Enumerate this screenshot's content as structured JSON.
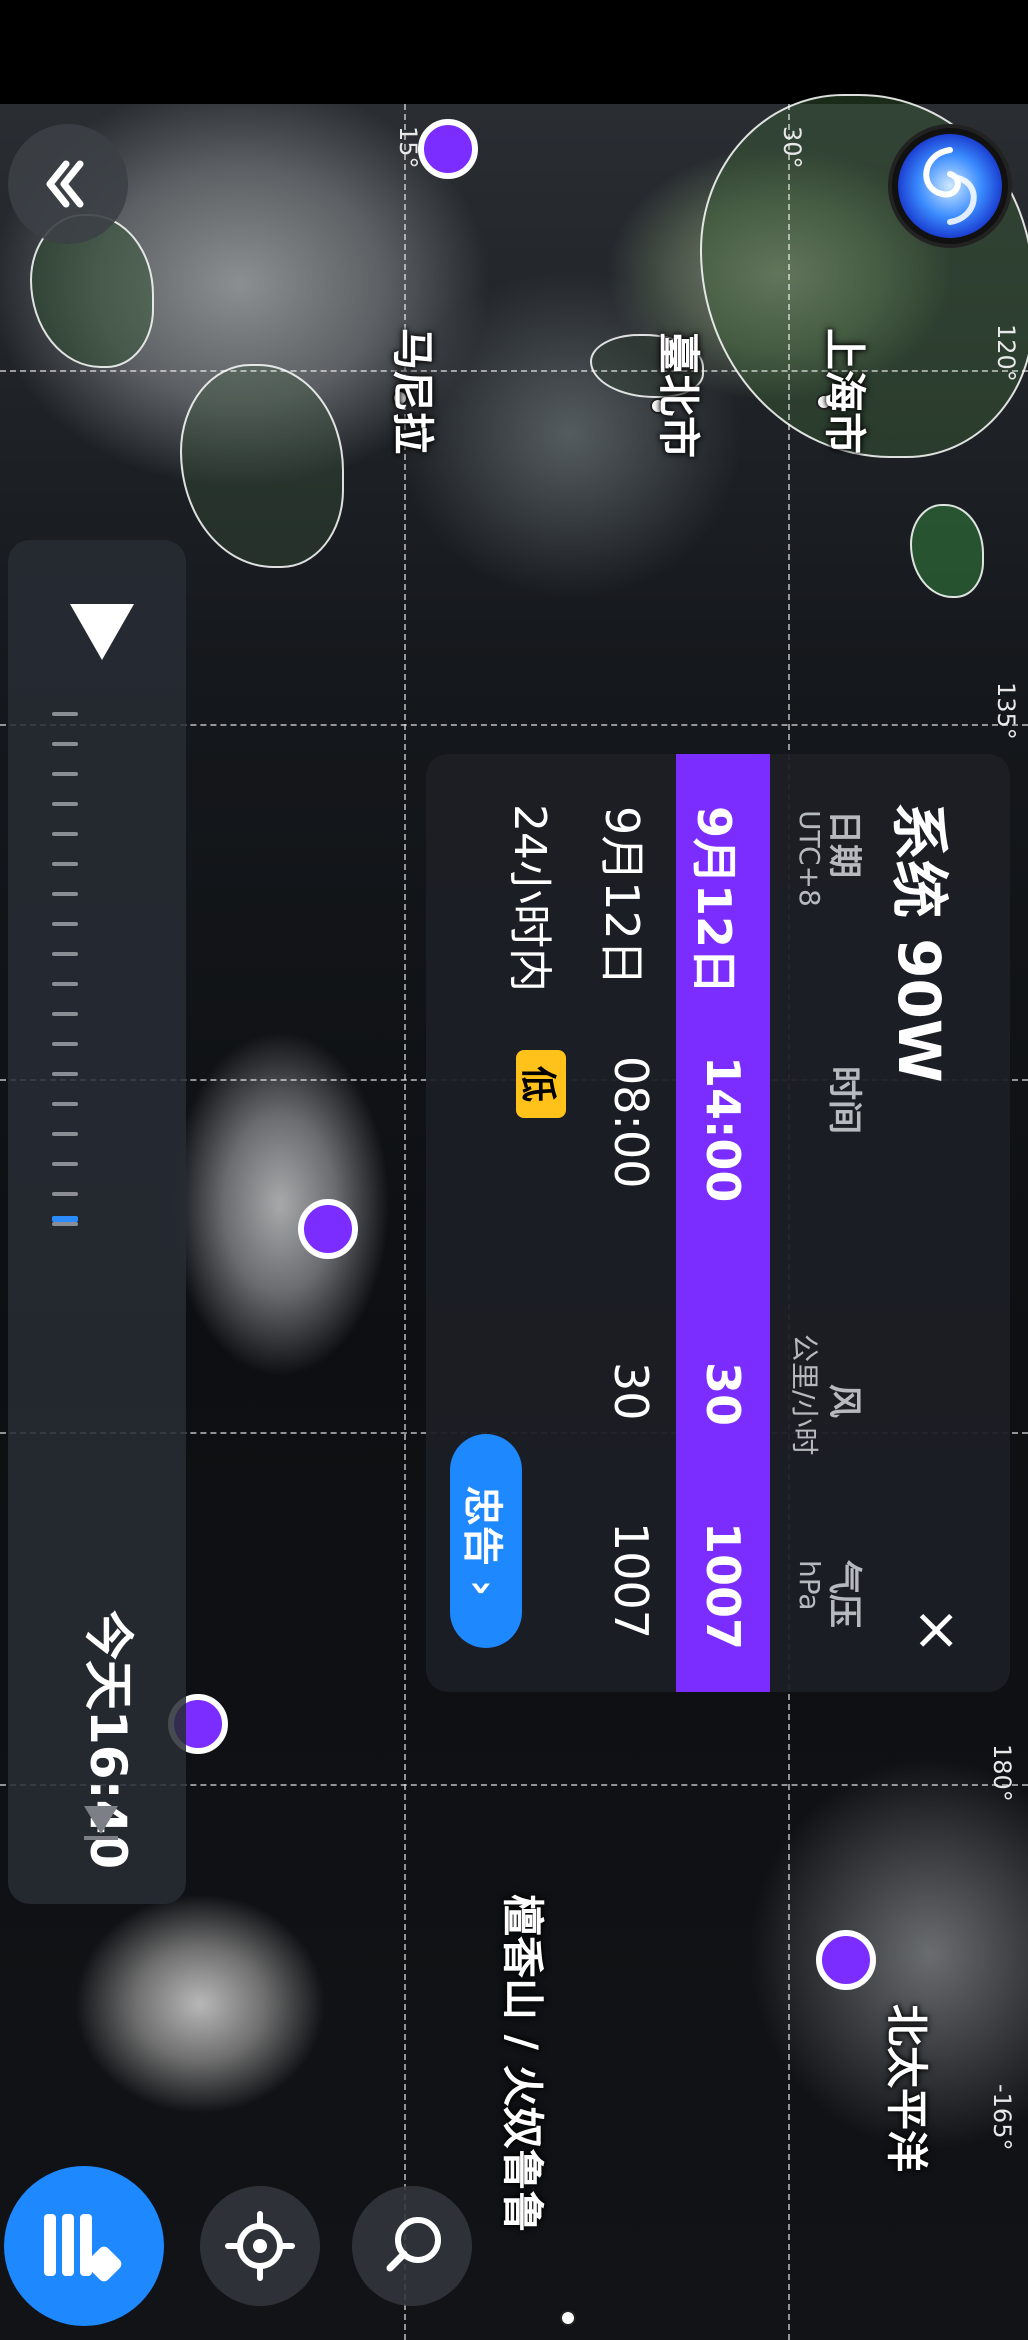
{
  "map": {
    "grid_labels": {
      "lat_15": "15°",
      "lat_30": "30°",
      "lon_120": "120°",
      "lon_135": "135°",
      "lon_180": "180°",
      "lon_neg165": "-165°"
    },
    "places": {
      "shanghai": "上海市",
      "taipei": "臺北市",
      "manila": "马尼拉",
      "north_pacific": "北太平洋",
      "honolulu": "檀香山 / 火奴鲁鲁"
    }
  },
  "timeline": {
    "current_label": "今天16:40"
  },
  "storm_card": {
    "title": "系统 90W",
    "close_label": "×",
    "header": {
      "date": "日期",
      "timezone": "UTC+8",
      "time": "时间",
      "wind": "风",
      "wind_unit": "公里/小时",
      "pressure": "气压",
      "pressure_unit": "hPa"
    },
    "rows": [
      {
        "date": "9月12日",
        "time": "14:00",
        "wind": "30",
        "pressure": "1007"
      },
      {
        "date": "9月12日",
        "time": "08:00",
        "wind": "30",
        "pressure": "1007"
      }
    ],
    "forecast": {
      "label": "24小时内",
      "badge": "低"
    },
    "warning_button": "忠告",
    "warning_chevron": "›"
  },
  "colors": {
    "accent_purple": "#7b2cff",
    "button_blue": "#1e88ff",
    "badge_yellow": "#ffc21a"
  },
  "icons": {
    "collapse": "double-chevron-icon",
    "logo": "typhoon-swirl-logo",
    "play": "play-triangle-icon",
    "play_end": "skip-end-icon",
    "layers": "layers-icon",
    "locate": "crosshair-icon",
    "search": "magnifier-icon"
  }
}
